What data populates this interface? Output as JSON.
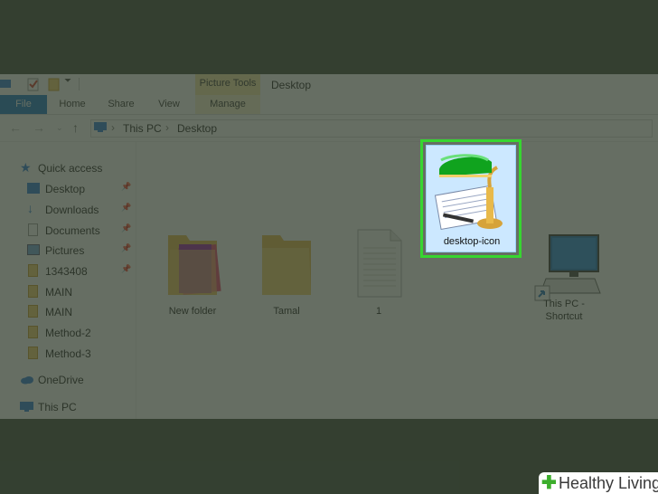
{
  "window": {
    "title": "Desktop",
    "context_tab": "Picture Tools"
  },
  "ribbon": {
    "tabs": [
      "File",
      "Home",
      "Share",
      "View",
      "Manage"
    ]
  },
  "address": {
    "crumbs": [
      "This PC",
      "Desktop"
    ]
  },
  "sidebar": {
    "quick_access": "Quick access",
    "items": [
      {
        "label": "Desktop",
        "icon": "desktop-icon",
        "pinned": true
      },
      {
        "label": "Downloads",
        "icon": "download-icon",
        "pinned": true
      },
      {
        "label": "Documents",
        "icon": "documents-icon",
        "pinned": true
      },
      {
        "label": "Pictures",
        "icon": "pictures-icon",
        "pinned": true
      },
      {
        "label": "1343408",
        "icon": "folder-icon",
        "pinned": true
      },
      {
        "label": "MAIN",
        "icon": "folder-icon",
        "pinned": false
      },
      {
        "label": "MAIN",
        "icon": "folder-icon",
        "pinned": false
      },
      {
        "label": "Method-2",
        "icon": "folder-icon",
        "pinned": false
      },
      {
        "label": "Method-3",
        "icon": "folder-icon",
        "pinned": false
      }
    ],
    "onedrive": "OneDrive",
    "this_pc": "This PC"
  },
  "files": [
    {
      "label": "New folder",
      "type": "folder-with-image"
    },
    {
      "label": "Tamal",
      "type": "folder"
    },
    {
      "label": "1",
      "type": "text-document"
    },
    {
      "label": "desktop-icon",
      "type": "image-lamp",
      "selected": true
    },
    {
      "label": "This PC - Shortcut",
      "type": "computer-shortcut"
    }
  ],
  "watermark": {
    "text": "Healthy Living"
  },
  "colors": {
    "accent": "#1979ca",
    "highlight": "#37d630",
    "selection": "#cce8ff",
    "overlay": "#303c2d"
  }
}
